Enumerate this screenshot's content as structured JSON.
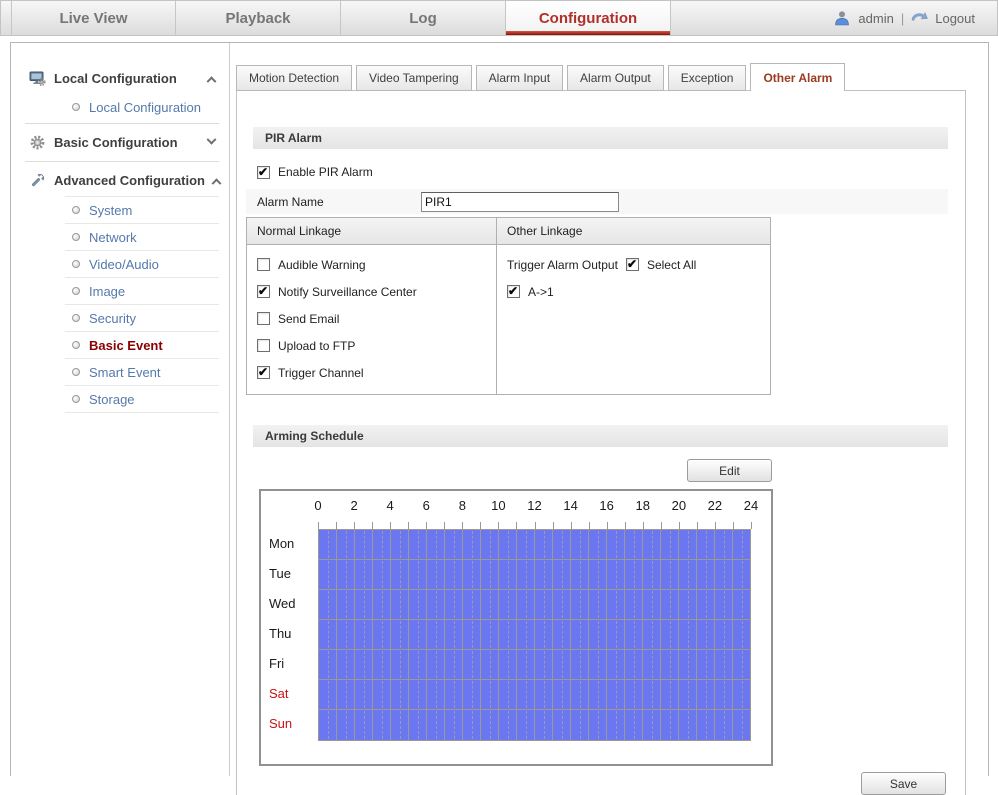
{
  "top_nav": {
    "items": [
      {
        "label": "Live View",
        "active": false
      },
      {
        "label": "Playback",
        "active": false
      },
      {
        "label": "Log",
        "active": false
      },
      {
        "label": "Configuration",
        "active": true
      }
    ],
    "user_name": "admin",
    "divider": "|",
    "logout_label": "Logout"
  },
  "sidebar": {
    "groups": [
      {
        "label": "Local Configuration",
        "icon": "monitor-gear",
        "state": "expanded",
        "items": [
          {
            "label": "Local Configuration",
            "selected": false
          }
        ]
      },
      {
        "label": "Basic Configuration",
        "icon": "gear",
        "state": "collapsed",
        "items": []
      },
      {
        "label": "Advanced Configuration",
        "icon": "wrench",
        "state": "expanded",
        "items": [
          {
            "label": "System",
            "selected": false
          },
          {
            "label": "Network",
            "selected": false
          },
          {
            "label": "Video/Audio",
            "selected": false
          },
          {
            "label": "Image",
            "selected": false
          },
          {
            "label": "Security",
            "selected": false
          },
          {
            "label": "Basic Event",
            "selected": true
          },
          {
            "label": "Smart Event",
            "selected": false
          },
          {
            "label": "Storage",
            "selected": false
          }
        ]
      }
    ]
  },
  "tabs": [
    {
      "label": "Motion Detection",
      "active": false
    },
    {
      "label": "Video Tampering",
      "active": false
    },
    {
      "label": "Alarm Input",
      "active": false
    },
    {
      "label": "Alarm Output",
      "active": false
    },
    {
      "label": "Exception",
      "active": false
    },
    {
      "label": "Other Alarm",
      "active": true
    }
  ],
  "pir": {
    "section_title": "PIR Alarm",
    "enable_label": "Enable PIR Alarm",
    "enable_checked": true,
    "alarm_name_label": "Alarm Name",
    "alarm_name_value": "PIR1"
  },
  "linkage": {
    "normal_header": "Normal Linkage",
    "other_header": "Other Linkage",
    "normal_items": [
      {
        "label": "Audible Warning",
        "checked": false
      },
      {
        "label": "Notify Surveillance Center",
        "checked": true
      },
      {
        "label": "Send Email",
        "checked": false
      },
      {
        "label": "Upload to FTP",
        "checked": false
      },
      {
        "label": "Trigger Channel",
        "checked": true
      }
    ],
    "other": {
      "trigger_alarm_output_label": "Trigger Alarm Output",
      "select_all_label": "Select All",
      "select_all_checked": true,
      "outputs": [
        {
          "label": "A->1",
          "checked": true
        }
      ]
    }
  },
  "arming": {
    "section_title": "Arming Schedule",
    "edit_button_label": "Edit",
    "schedule": {
      "hours_per_day": 24,
      "hour_label_values": [
        0,
        2,
        4,
        6,
        8,
        10,
        12,
        14,
        16,
        18,
        20,
        22,
        24
      ],
      "days": [
        {
          "label": "Mon",
          "weekend": false,
          "armed_ranges": [
            [
              0,
              24
            ]
          ]
        },
        {
          "label": "Tue",
          "weekend": false,
          "armed_ranges": [
            [
              0,
              24
            ]
          ]
        },
        {
          "label": "Wed",
          "weekend": false,
          "armed_ranges": [
            [
              0,
              24
            ]
          ]
        },
        {
          "label": "Thu",
          "weekend": false,
          "armed_ranges": [
            [
              0,
              24
            ]
          ]
        },
        {
          "label": "Fri",
          "weekend": false,
          "armed_ranges": [
            [
              0,
              24
            ]
          ]
        },
        {
          "label": "Sat",
          "weekend": true,
          "armed_ranges": [
            [
              0,
              24
            ]
          ]
        },
        {
          "label": "Sun",
          "weekend": true,
          "armed_ranges": [
            [
              0,
              24
            ]
          ]
        }
      ]
    }
  },
  "footer": {
    "save_button_label": "Save"
  },
  "colors": {
    "nav_active_red": "#b2302a",
    "tab_active_red": "#9a3b22",
    "link_blue": "#5579ab",
    "selected_item_red": "#8b0000",
    "weekend_red": "#cc1111",
    "armed_blue": "#6b76f1",
    "grid_line": "#9a9a8e"
  }
}
